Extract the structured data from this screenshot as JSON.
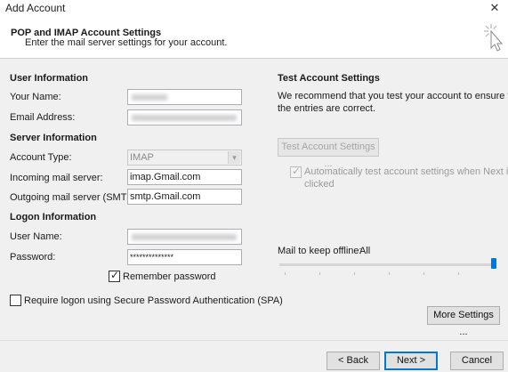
{
  "window": {
    "title": "Add Account",
    "close_glyph": "✕"
  },
  "header": {
    "title": "POP and IMAP Account Settings",
    "subtitle": "Enter the mail server settings for your account."
  },
  "user_info": {
    "title": "User Information",
    "your_name_label": "Your Name:",
    "email_label": "Email Address:"
  },
  "server_info": {
    "title": "Server Information",
    "account_type_label": "Account Type:",
    "account_type_value": "IMAP",
    "incoming_label": "Incoming mail server:",
    "incoming_value": "imap.Gmail.com",
    "outgoing_label": "Outgoing mail server (SMTP):",
    "outgoing_value": "smtp.Gmail.com"
  },
  "logon_info": {
    "title": "Logon Information",
    "username_label": "User Name:",
    "password_label": "Password:",
    "password_value": "**************",
    "remember_label": "Remember password",
    "spa_label": "Require logon using Secure Password Authentication (SPA)"
  },
  "test_settings": {
    "title": "Test Account Settings",
    "description_line1": "We recommend that you test your account to ensure that",
    "description_line2": "the entries are correct.",
    "test_button": "Test Account Settings ...",
    "auto_test_line1": "Automatically test account settings when Next is",
    "auto_test_line2": "clicked"
  },
  "offline": {
    "label": "Mail to keep offline:",
    "value": "All",
    "slider_level": 1.0
  },
  "buttons": {
    "more_settings": "More Settings ...",
    "back": "< Back",
    "next": "Next >",
    "cancel": "Cancel"
  },
  "icons": {
    "close": "close-icon",
    "wizard": "wizard-cursor-icon",
    "dropdown": "chevron-down-icon",
    "check": "checkmark-icon"
  },
  "colors": {
    "accent": "#0078d7",
    "background": "#f0f0f0"
  }
}
